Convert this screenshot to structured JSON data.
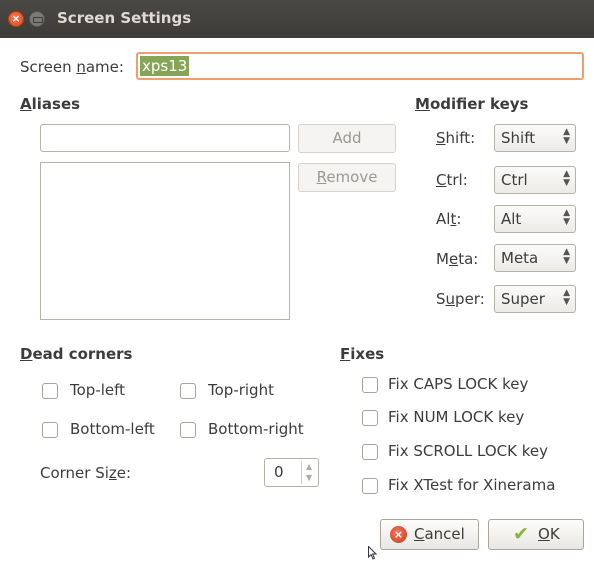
{
  "window": {
    "title": "Screen Settings"
  },
  "screen_name": {
    "label_pre": "Screen ",
    "label_u": "n",
    "label_post": "ame:",
    "value": "xps13"
  },
  "aliases": {
    "header_u": "A",
    "header_post": "liases",
    "add_label": "Add",
    "remove_u": "R",
    "remove_post": "emove"
  },
  "modifier_keys": {
    "header_u": "M",
    "header_post": "odifier keys",
    "rows": [
      {
        "label_pre": "",
        "label_u": "S",
        "label_post": "hift:",
        "value": "Shift"
      },
      {
        "label_pre": "",
        "label_u": "C",
        "label_post": "trl:",
        "value": "Ctrl"
      },
      {
        "label_pre": "Al",
        "label_u": "t",
        "label_post": ":",
        "value": "Alt"
      },
      {
        "label_pre": "M",
        "label_u": "e",
        "label_post": "ta:",
        "value": "Meta"
      },
      {
        "label_pre": "S",
        "label_u": "u",
        "label_post": "per:",
        "value": "Super"
      }
    ]
  },
  "dead_corners": {
    "header_u": "D",
    "header_post": "ead corners",
    "top_left": "Top-left",
    "top_right": "Top-right",
    "bottom_left": "Bottom-left",
    "bottom_right": "Bottom-right",
    "corner_size_pre": "Corner Si",
    "corner_size_u": "z",
    "corner_size_post": "e:",
    "corner_size_value": "0"
  },
  "fixes": {
    "header_u": "F",
    "header_post": "ixes",
    "items": [
      "Fix CAPS LOCK key",
      "Fix NUM LOCK key",
      "Fix SCROLL LOCK key",
      "Fix XTest for Xinerama"
    ]
  },
  "buttons": {
    "cancel_u": "C",
    "cancel_post": "ancel",
    "ok_u": "O",
    "ok_post": "K"
  },
  "checkbox_states": {
    "top_left": false,
    "top_right": false,
    "bottom_left": false,
    "bottom_right": false,
    "fix_caps": false,
    "fix_num": false,
    "fix_scroll": false,
    "fix_xtest": false
  }
}
